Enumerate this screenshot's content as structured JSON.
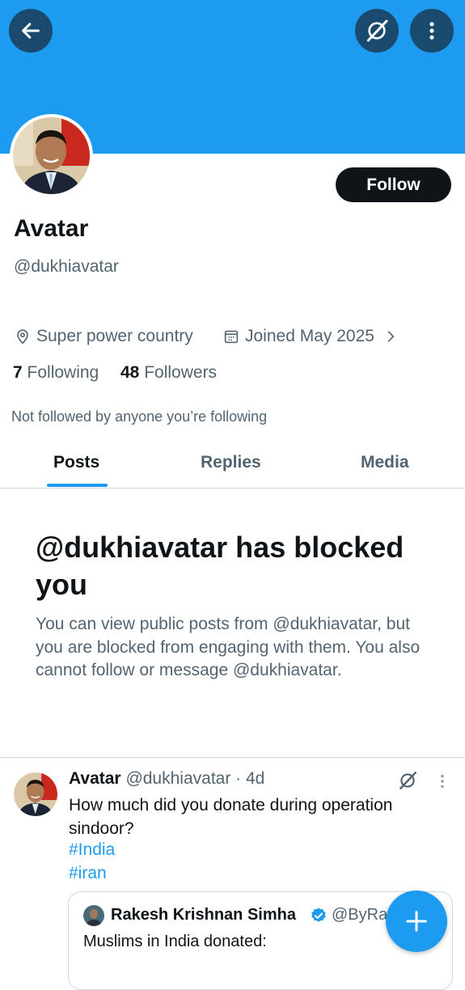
{
  "header": {
    "back_icon": "arrow-left-icon",
    "grok_icon": "grok-icon",
    "more_icon": "more-vertical-icon",
    "banner_color": "#1d9bf0"
  },
  "profile": {
    "name": "Avatar",
    "handle": "@dukhiavatar",
    "follow_label": "Follow",
    "location": "Super power country",
    "joined": "Joined May 2025",
    "following_count": "7",
    "following_label": "Following",
    "followers_count": "48",
    "followers_label": "Followers",
    "not_followed_text": "Not followed by anyone you’re following"
  },
  "tabs": [
    {
      "label": "Posts",
      "active": true
    },
    {
      "label": "Replies",
      "active": false
    },
    {
      "label": "Media",
      "active": false
    }
  ],
  "blocked": {
    "title": "@dukhiavatar has blocked you",
    "description": "You can view public posts from @dukhiavatar, but you are blocked from engaging with them. You also cannot follow or message @dukhiavatar."
  },
  "tweet": {
    "author_name": "Avatar",
    "author_meta": "@dukhiavatar · 4d",
    "text": "How much did you donate during operation sindoor?",
    "hashtags": [
      "#India",
      "#iran"
    ],
    "quote": {
      "author_name": "Rakesh Krishnan Simha",
      "author_handle": "@ByRa",
      "text": "Muslims in India donated:"
    }
  },
  "fab": {
    "icon": "plus-icon"
  },
  "colors": {
    "accent": "#1d9bf0",
    "text": "#0f1419",
    "muted": "#536471",
    "verified": "#1d9bf0"
  }
}
